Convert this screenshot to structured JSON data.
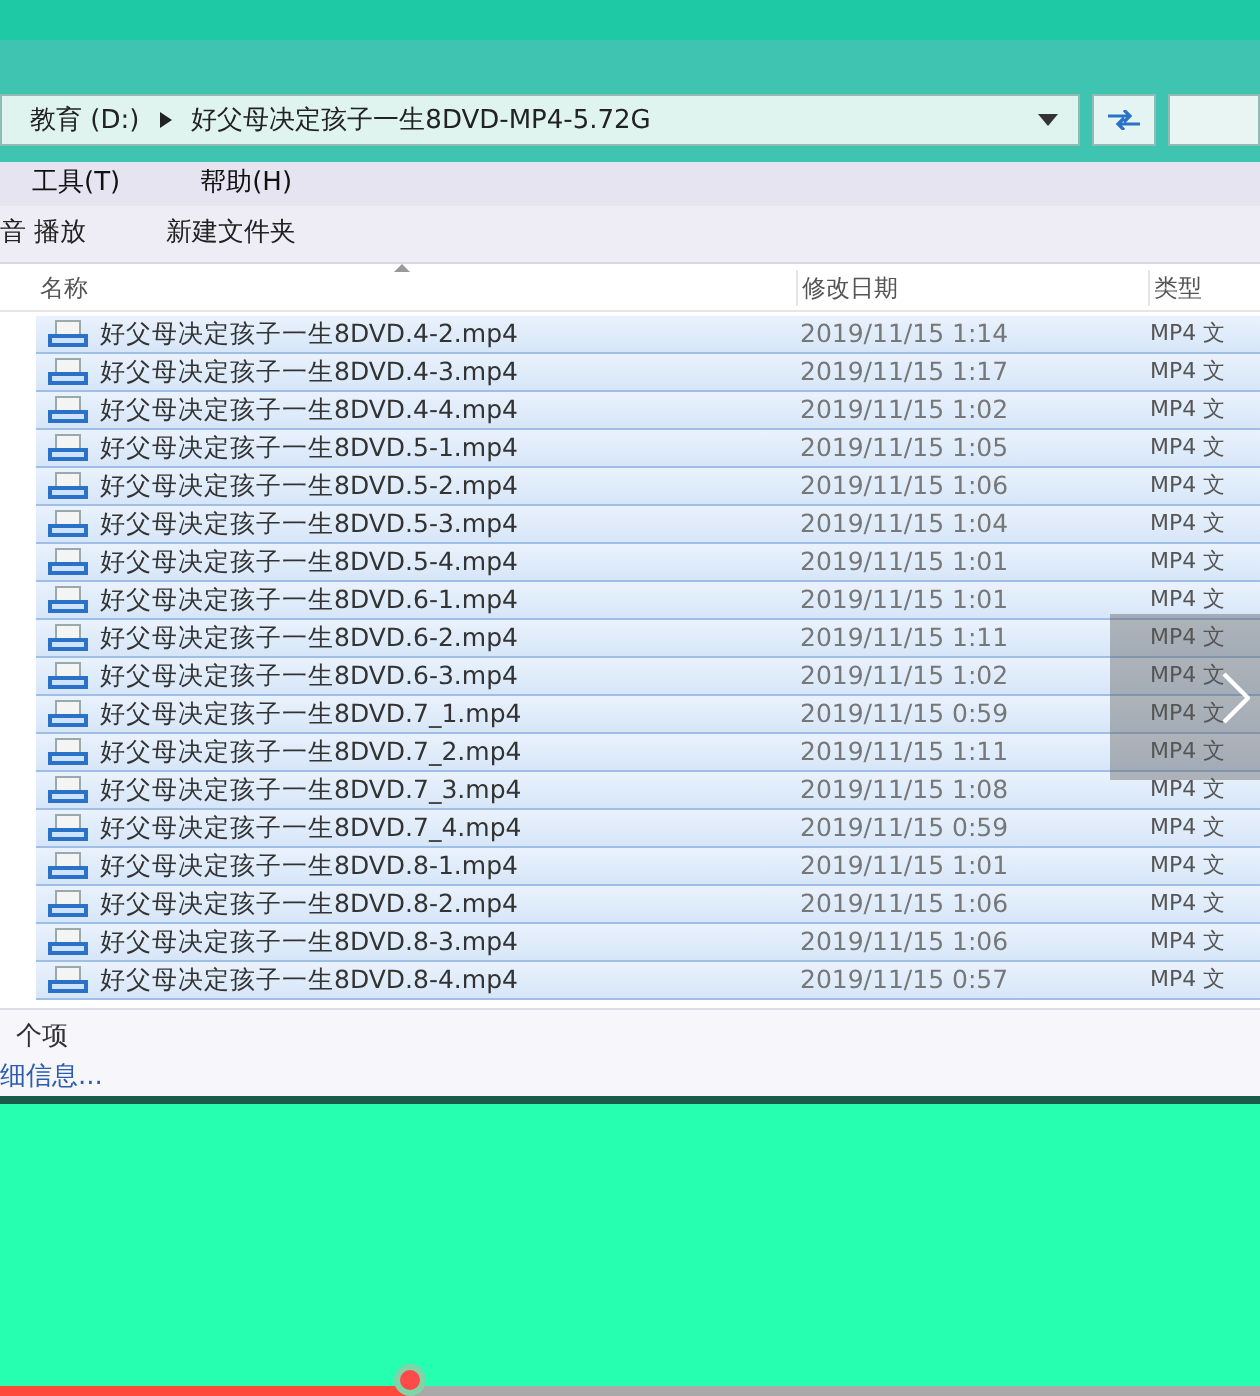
{
  "address_bar": {
    "drive": "教育 (D:)",
    "folder": "好父母决定孩子一生8DVD-MP4-5.72G"
  },
  "menu": [
    "工具(T)",
    "帮助(H)"
  ],
  "toolbar": [
    "音 播放",
    "新建文件夹"
  ],
  "columns": [
    "名称",
    "修改日期",
    "类型"
  ],
  "files": [
    {
      "name": "好父母决定孩子一生8DVD.4-2.mp4",
      "date": "2019/11/15 1:14",
      "type": "MP4 文",
      "selected": true
    },
    {
      "name": "好父母决定孩子一生8DVD.4-3.mp4",
      "date": "2019/11/15 1:17",
      "type": "MP4 文",
      "selected": true
    },
    {
      "name": "好父母决定孩子一生8DVD.4-4.mp4",
      "date": "2019/11/15 1:02",
      "type": "MP4 文",
      "selected": true
    },
    {
      "name": "好父母决定孩子一生8DVD.5-1.mp4",
      "date": "2019/11/15 1:05",
      "type": "MP4 文",
      "selected": true
    },
    {
      "name": "好父母决定孩子一生8DVD.5-2.mp4",
      "date": "2019/11/15 1:06",
      "type": "MP4 文",
      "selected": true
    },
    {
      "name": "好父母决定孩子一生8DVD.5-3.mp4",
      "date": "2019/11/15 1:04",
      "type": "MP4 文",
      "selected": true
    },
    {
      "name": "好父母决定孩子一生8DVD.5-4.mp4",
      "date": "2019/11/15 1:01",
      "type": "MP4 文",
      "selected": true
    },
    {
      "name": "好父母决定孩子一生8DVD.6-1.mp4",
      "date": "2019/11/15 1:01",
      "type": "MP4 文",
      "selected": true
    },
    {
      "name": "好父母决定孩子一生8DVD.6-2.mp4",
      "date": "2019/11/15 1:11",
      "type": "MP4 文",
      "selected": true
    },
    {
      "name": "好父母决定孩子一生8DVD.6-3.mp4",
      "date": "2019/11/15 1:02",
      "type": "MP4 文",
      "selected": true
    },
    {
      "name": "好父母决定孩子一生8DVD.7_1.mp4",
      "date": "2019/11/15 0:59",
      "type": "MP4 文",
      "selected": true
    },
    {
      "name": "好父母决定孩子一生8DVD.7_2.mp4",
      "date": "2019/11/15 1:11",
      "type": "MP4 文",
      "selected": true
    },
    {
      "name": "好父母决定孩子一生8DVD.7_3.mp4",
      "date": "2019/11/15 1:08",
      "type": "MP4 文",
      "selected": true
    },
    {
      "name": "好父母决定孩子一生8DVD.7_4.mp4",
      "date": "2019/11/15 0:59",
      "type": "MP4 文",
      "selected": true
    },
    {
      "name": "好父母决定孩子一生8DVD.8-1.mp4",
      "date": "2019/11/15 1:01",
      "type": "MP4 文",
      "selected": true
    },
    {
      "name": "好父母决定孩子一生8DVD.8-2.mp4",
      "date": "2019/11/15 1:06",
      "type": "MP4 文",
      "selected": true
    },
    {
      "name": "好父母决定孩子一生8DVD.8-3.mp4",
      "date": "2019/11/15 1:06",
      "type": "MP4 文",
      "selected": true
    },
    {
      "name": "好父母决定孩子一生8DVD.8-4.mp4",
      "date": "2019/11/15 0:57",
      "type": "MP4 文",
      "selected": true
    }
  ],
  "status": [
    "个项",
    "细信息..."
  ],
  "video": {
    "level": 0.325
  }
}
